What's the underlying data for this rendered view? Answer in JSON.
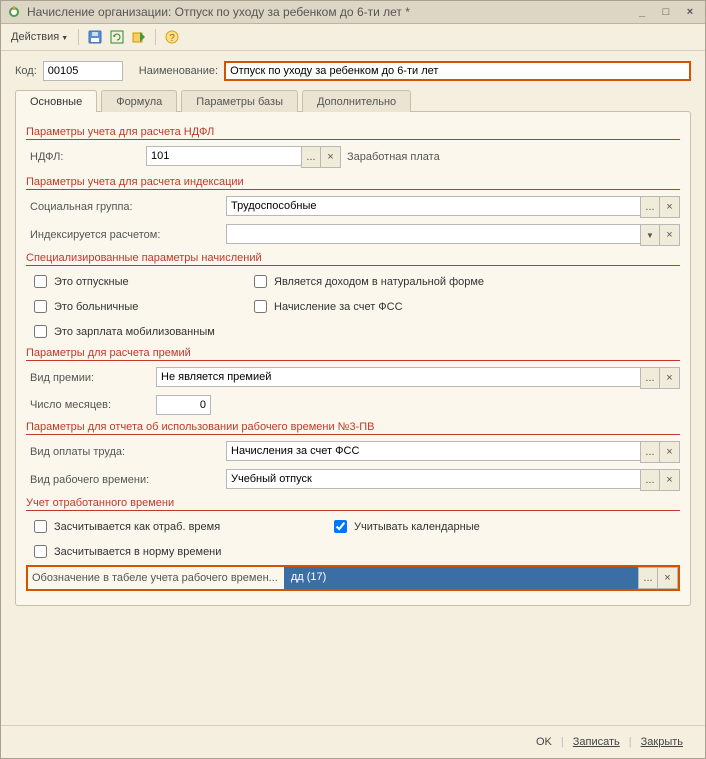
{
  "title": "Начисление организации: Отпуск по уходу за ребенком до 6-ти лет *",
  "toolbar": {
    "actions_label": "Действия"
  },
  "form": {
    "code_label": "Код:",
    "code_value": "00105",
    "name_label": "Наименование:",
    "name_value": "Отпуск по уходу за ребенком до 6-ти лет"
  },
  "tabs": {
    "t0": "Основные",
    "t1": "Формула",
    "t2": "Параметры базы",
    "t3": "Дополнительно"
  },
  "sect": {
    "ndfl_header": "Параметры учета для расчета НДФЛ",
    "ndfl_label": "НДФЛ:",
    "ndfl_code": "101",
    "ndfl_text": "Заработная плата",
    "index_header": "Параметры учета для расчета индексации",
    "soc_label": "Социальная группа:",
    "soc_value": "Трудоспособные",
    "index_label": "Индексируется расчетом:",
    "index_value": "",
    "spec_header": "Специализированные параметры начислений",
    "chk_vac": "Это отпускные",
    "chk_natural": "Является доходом в натуральной форме",
    "chk_sick": "Это больничные",
    "chk_fss": "Начисление за счет ФСС",
    "chk_mobil": "Это зарплата мобилизованным",
    "bonus_header": "Параметры для расчета премий",
    "bonus_type_label": "Вид премии:",
    "bonus_type_value": "Не является премией",
    "bonus_months_label": "Число месяцев:",
    "bonus_months_value": "0",
    "report_header": "Параметры для отчета об использовании рабочего времени №3-ПВ",
    "pay_type_label": "Вид оплаты труда:",
    "pay_type_value": "Начисления за счет ФСС",
    "work_type_label": "Вид рабочего времени:",
    "work_type_value": "Учебный отпуск",
    "time_header": "Учет отработанного времени",
    "chk_counts_worked": "Засчитывается как отраб. время",
    "chk_calendar": "Учитывать календарные",
    "chk_norm": "Засчитывается в норму времени",
    "timecode_label": "Обозначение в табеле учета рабочего времен...",
    "timecode_value": "дд (17)"
  },
  "footer": {
    "ok": "OK",
    "save": "Записать",
    "close": "Закрыть"
  },
  "glyph": {
    "dots": "...",
    "x": "×",
    "dd": "▼"
  }
}
